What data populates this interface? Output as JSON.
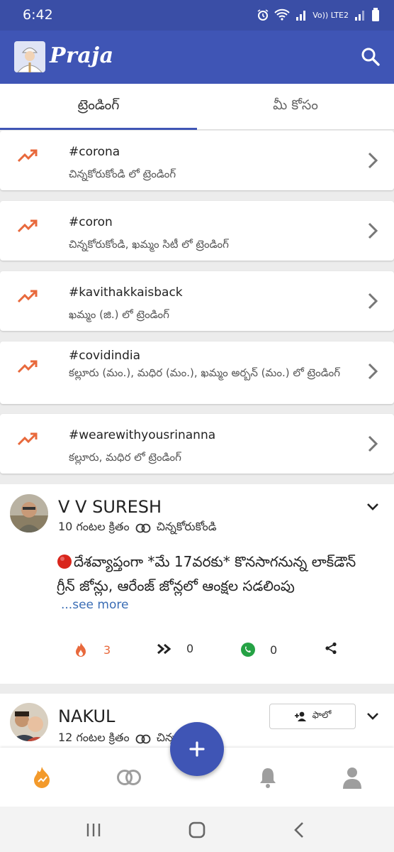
{
  "status_bar": {
    "time": "6:42",
    "network_label": "Vo)) LTE2",
    "icons": [
      "alarm-icon",
      "wifi-icon",
      "signal-icon",
      "signal-icon",
      "battery-icon"
    ]
  },
  "header": {
    "app_name": "Praja",
    "accent": "#3f55b5"
  },
  "tabs": [
    {
      "label": "ట్రెండింగ్",
      "active": true
    },
    {
      "label": "మీ కోసం",
      "active": false
    }
  ],
  "trending": [
    {
      "tag": "#corona",
      "subtitle": "చిన్నకోరుకోండి లో ట్రెండింగ్"
    },
    {
      "tag": "#coron",
      "subtitle": "చిన్నకోరుకోండి, ఖమ్మం సిటీ లో ట్రెండింగ్"
    },
    {
      "tag": "#kavithakkaisback",
      "subtitle": "ఖమ్మం (జి.) లో ట్రెండింగ్"
    },
    {
      "tag": "#covidindia",
      "subtitle": "కల్లూరు (మం.), మధిర (మం.), ఖమ్మం అర్బన్ (మం.) లో ట్రెండింగ్"
    },
    {
      "tag": "#wearewithyousrinanna",
      "subtitle": "కల్లూరు, మధిర లో ట్రెండింగ్"
    }
  ],
  "posts": [
    {
      "author": "V V SURESH",
      "time_ago": "10 గంటల క్రితం",
      "location": "చిన్నకోరుకోండి",
      "text_line1": "దేశవ్యాప్తంగా *మే 17వరకు* కొనసాగనున్న లాక్‌డౌన్",
      "text_line2": "గ్రీన్ జోన్లు, ఆరేంజ్ జోన్లలో ఆంక్షల సడలింపు",
      "see_more": "...see more",
      "likes": "3",
      "shares": "0",
      "whatsapp_shares": "0"
    },
    {
      "author": "NAKUL",
      "time_ago": "12 గంటల క్రితం",
      "location": "చిన్నకోరుకోండి",
      "follow_label": "ఫాలో"
    }
  ],
  "colors": {
    "trend_orange": "#e8693c",
    "link_blue": "#3a6db5",
    "whatsapp_green": "#25a244"
  }
}
